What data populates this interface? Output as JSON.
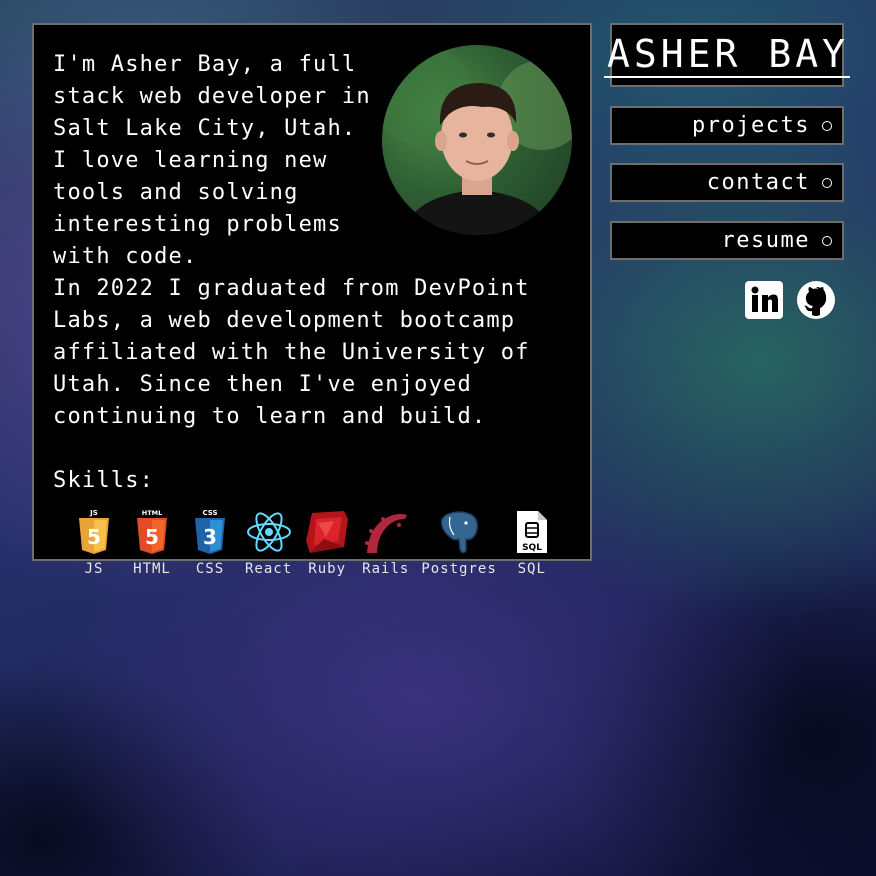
{
  "about": {
    "bio": "I'm Asher Bay, a full stack web developer in Salt Lake City, Utah. I love learning new tools and solving interesting problems with code.\nIn 2022 I graduated from DevPoint Labs, a web development bootcamp affiliated with the University of Utah. Since then I've enjoyed continuing to learn and build.",
    "skills_heading": "Skills:",
    "skills": [
      {
        "label": "JS",
        "icon": "js-icon"
      },
      {
        "label": "HTML",
        "icon": "html5-icon"
      },
      {
        "label": "CSS",
        "icon": "css3-icon"
      },
      {
        "label": "React",
        "icon": "react-icon"
      },
      {
        "label": "Ruby",
        "icon": "ruby-icon"
      },
      {
        "label": "Rails",
        "icon": "rails-icon"
      },
      {
        "label": "Postgres",
        "icon": "postgres-icon"
      },
      {
        "label": "SQL",
        "icon": "sql-file-icon"
      }
    ]
  },
  "header": {
    "title": "ASHER BAY"
  },
  "nav": {
    "items": [
      {
        "label": "projects"
      },
      {
        "label": "contact"
      },
      {
        "label": "resume"
      }
    ]
  },
  "social": {
    "items": [
      {
        "icon": "linkedin-icon"
      },
      {
        "icon": "github-icon"
      }
    ]
  },
  "colors": {
    "card_background": "#000000",
    "card_border": "#6e6e6e",
    "text": "#ffffff"
  }
}
